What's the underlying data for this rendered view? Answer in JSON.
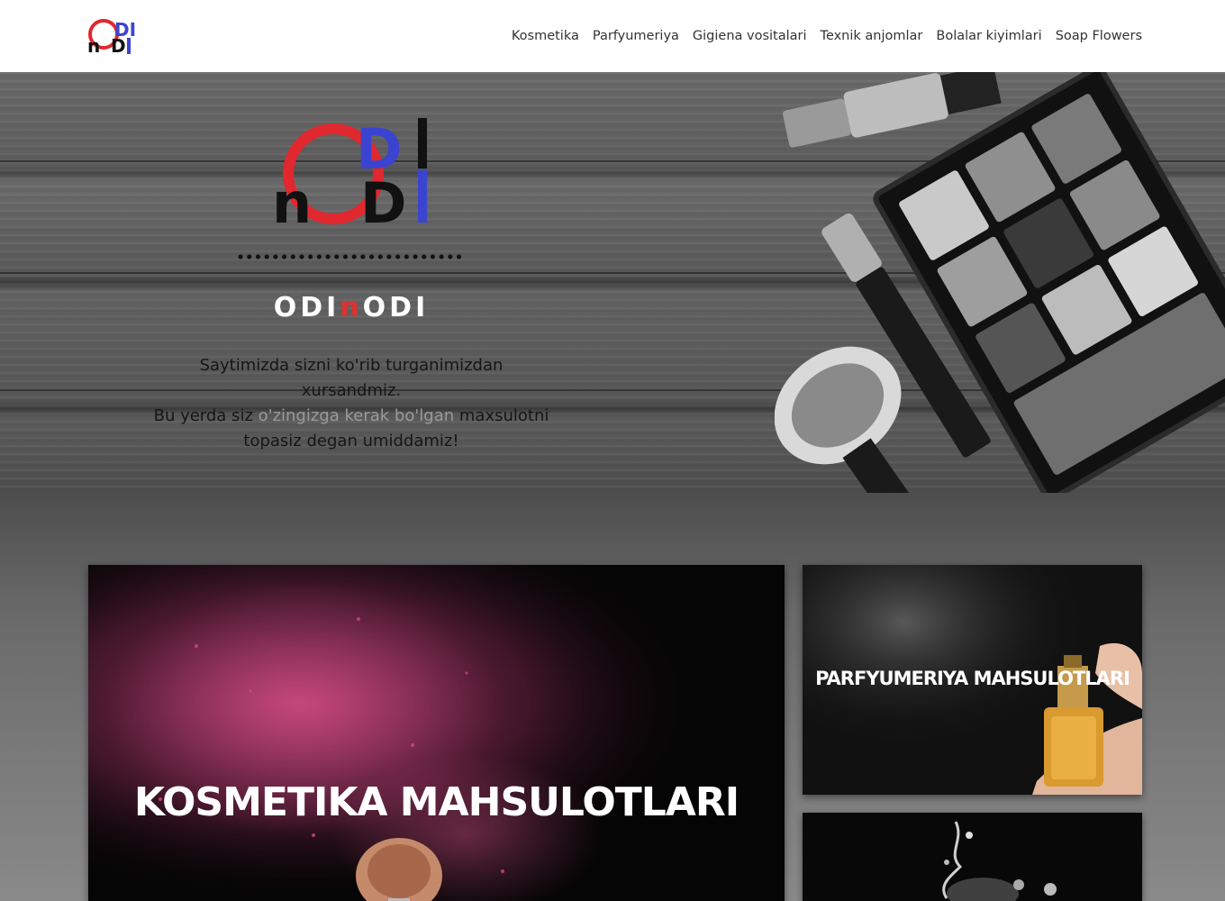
{
  "brand": {
    "logo_letters": {
      "top": "DI",
      "circle": "O",
      "bottom_left": "n",
      "bottom_right": "DI"
    },
    "colors": {
      "red": "#e0282e",
      "blue": "#3b44d1",
      "black": "#111111"
    }
  },
  "nav": {
    "items": [
      {
        "label": "Kosmetika"
      },
      {
        "label": "Parfyumeriya"
      },
      {
        "label": "Gigiena vositalari"
      },
      {
        "label": "Texnik anjomlar"
      },
      {
        "label": "Bolalar kiyimlari"
      },
      {
        "label": "Soap Flowers"
      }
    ]
  },
  "hero": {
    "title_part1": "ODI",
    "title_part2": "n",
    "title_part3": "ODI",
    "text_line1": "Saytimizda sizni ko'rib turganimizdan",
    "text_line2": "xursandmiz.",
    "text_line3a": "Bu yerda siz ",
    "text_line3b": "o'zingizga kerak bo'lgan",
    "text_line3c": " maxsulotni",
    "text_line4": "topasiz degan umiddamiz!"
  },
  "cards": {
    "cosmetics": {
      "label": "KOSMETIKA MAHSULOTLARI",
      "accent": "#c8437a"
    },
    "perfume": {
      "label": "PARFYUMERIYA MAHSULOTLARI",
      "accent": "#d99a30"
    }
  },
  "icons": [
    "brand-logo",
    "eyeshadow-palette",
    "makeup-brush",
    "perfume-bottle",
    "water-splash"
  ]
}
